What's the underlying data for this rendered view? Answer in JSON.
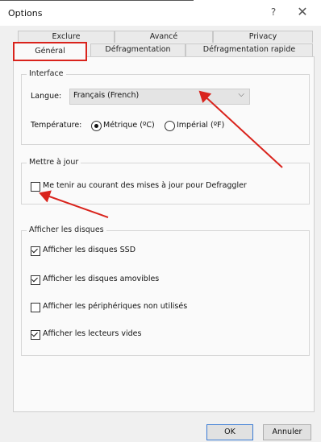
{
  "window": {
    "title": "Options",
    "help_glyph": "?",
    "close_glyph": "✕"
  },
  "tabs": {
    "row1": [
      "Exclure",
      "Avancé",
      "Privacy"
    ],
    "row2": [
      "Général",
      "Défragmentation",
      "Défragmentation rapide"
    ],
    "active": "Général"
  },
  "interface": {
    "group_title": "Interface",
    "language_label": "Langue:",
    "language_value": "Français (French)",
    "temperature_label": "Température:",
    "temp_options": [
      "Métrique (ºC)",
      "Impérial (ºF)"
    ],
    "temp_selected": "Métrique (ºC)"
  },
  "update": {
    "group_title": "Mettre à jour",
    "keep_informed_label": "Me tenir au courant des mises à jour pour Defraggler",
    "keep_informed_checked": false
  },
  "drives": {
    "group_title": "Afficher les disques",
    "items": [
      {
        "label": "Afficher les disques SSD",
        "checked": true
      },
      {
        "label": "Afficher les disques amovibles",
        "checked": true
      },
      {
        "label": "Afficher les périphériques non utilisés",
        "checked": false
      },
      {
        "label": "Afficher les lecteurs vides",
        "checked": true
      }
    ]
  },
  "footer": {
    "ok_label": "OK",
    "cancel_label": "Annuler"
  },
  "colors": {
    "annotation_red": "#d9231c",
    "ok_border": "#3a7bd5"
  },
  "icons": {
    "help": "help-icon",
    "close": "close-icon",
    "dropdown": "chevron-down-icon",
    "arrow": "annotation-arrow"
  }
}
